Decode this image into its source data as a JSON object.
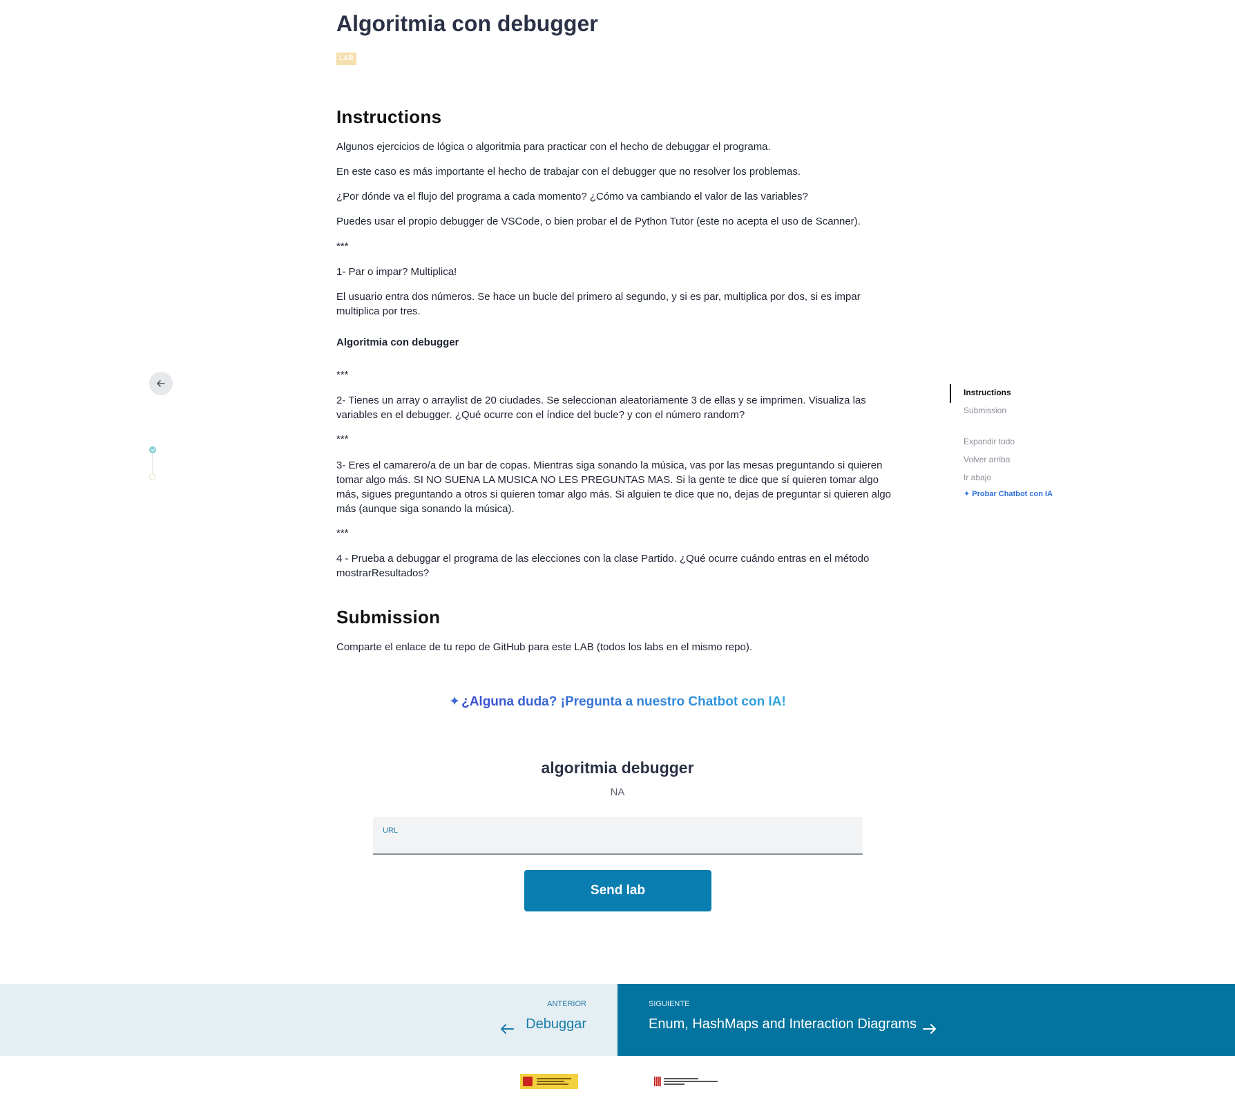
{
  "lesson": {
    "title": "Algoritmia con debugger",
    "badge": "LAB"
  },
  "instructions": {
    "heading": "Instructions",
    "paragraphs": [
      "Algunos ejercicios de lógica o algoritmia para practicar con el hecho de debuggar el programa.",
      "En este caso es más importante el hecho de trabajar con el debugger que no resolver los problemas.",
      "¿Por dónde va el flujo del programa a cada momento? ¿Cómo va cambiando el valor de las variables?",
      "Puedes usar el propio debugger de VSCode, o bien probar el de Python Tutor (este no acepta el uso de Scanner).",
      "***",
      "1- Par o impar? Multiplica!",
      "El usuario entra dos números. Se hace un bucle del primero al segundo, y si es par, multiplica por dos, si es impar multiplica por tres.",
      "Algoritmia con debugger",
      "***",
      "2- Tienes un array o arraylist de 20 ciudades. Se seleccionan aleatoriamente 3 de ellas y se imprimen. Visualiza las variables en el debugger. ¿Qué ocurre con el índice del bucle? y con el número random?",
      "***",
      "3- Eres el camarero/a de un bar de copas. Mientras siga sonando la música, vas por las mesas preguntando si quieren tomar algo más. SI NO SUENA LA MUSICA NO LES PREGUNTAS MAS. Si la gente te dice que sí quieren tomar algo más, sigues preguntando a otros si quieren tomar algo más. Si alguien te dice que no, dejas de preguntar si quieren algo más (aunque siga sonando la música).",
      "***",
      "4 - Prueba a debuggar el programa de las elecciones con la clase Partido. ¿Qué ocurre cuándo entras en el método mostrarResultados?"
    ]
  },
  "submission": {
    "heading": "Submission",
    "text": "Comparte el enlace de tu repo de GitHub para este LAB (todos los labs en el mismo repo)."
  },
  "chatbot": {
    "spark_icon": "sparkle-icon",
    "text": "¿Alguna duda? ¡Pregunta a nuestro Chatbot con IA!"
  },
  "form": {
    "title": "algoritmia debugger",
    "status": "NA",
    "url_label": "URL",
    "url_value": "",
    "submit_label": "Send lab"
  },
  "toc": {
    "items": [
      "Instructions",
      "Submission"
    ],
    "actions": [
      "Expandir todo",
      "Volver arriba",
      "Ir abajo"
    ],
    "ai_link": "Probar Chatbot con IA"
  },
  "nav": {
    "prev_caption": "ANTERIOR",
    "prev_title": "Debuggar",
    "next_caption": "SIGUIENTE",
    "next_title": "Enum, HashMaps and Interaction Diagrams"
  },
  "colors": {
    "accent": "#0a7db1",
    "next_bg": "#02749f",
    "prev_bg": "#e4eef3",
    "badge": "#f6dfae"
  }
}
